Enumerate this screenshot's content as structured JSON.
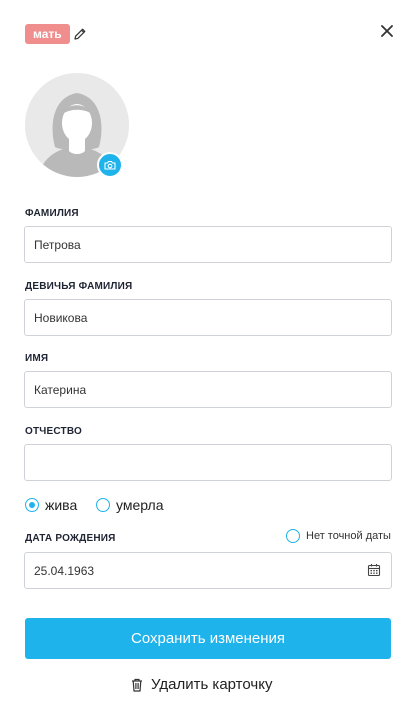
{
  "header": {
    "relation_badge": "мать",
    "edit_icon": "pencil-icon",
    "close_icon": "close-icon"
  },
  "avatar": {
    "placeholder_icon": "female-silhouette-icon",
    "upload_icon": "camera-icon"
  },
  "form": {
    "surname": {
      "label": "ФАМИЛИЯ",
      "value": "Петрова"
    },
    "maiden_name": {
      "label": "ДЕВИЧЬЯ ФАМИЛИЯ",
      "value": "Новикова"
    },
    "first_name": {
      "label": "ИМЯ",
      "value": "Катерина"
    },
    "patronymic": {
      "label": "ОТЧЕСТВО",
      "value": ""
    },
    "status": {
      "alive_label": "жива",
      "deceased_label": "умерла",
      "selected": "alive"
    },
    "birth_date": {
      "label": "ДАТА РОЖДЕНИЯ",
      "value": "25.04.1963",
      "no_exact_date_label": "Нет точной даты",
      "calendar_icon": "calendar-icon"
    }
  },
  "actions": {
    "save_label": "Сохранить изменения",
    "delete_label": "Удалить карточку",
    "delete_icon": "trash-icon"
  },
  "colors": {
    "accent": "#1fb3ec",
    "badge": "#f08e8e",
    "border": "#cfd3d8"
  }
}
